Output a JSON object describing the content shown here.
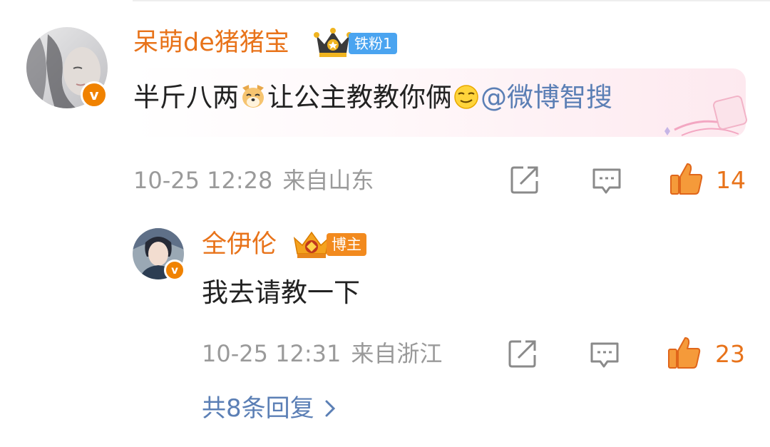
{
  "comment": {
    "username": "呆萌de猪猪宝",
    "fan_badge": "铁粉1",
    "text_before": "半斤八两",
    "text_middle": "让公主教教你俩",
    "mention": "@微博智搜",
    "time": "10-25 12:28",
    "location": "来自山东",
    "like_count": "14"
  },
  "reply": {
    "username": "全伊伦",
    "host_badge": "博主",
    "text": "我去请教一下",
    "time": "10-25 12:31",
    "location": "来自浙江",
    "like_count": "23"
  },
  "more_replies_label": "共8条回复",
  "colors": {
    "username": "#e8731a",
    "link": "#5b7fb5",
    "meta": "#9a9a9a",
    "fan_badge": "#4aa4f0",
    "host_badge": "#f28a1e"
  },
  "icons": [
    "share-icon",
    "comment-icon",
    "thumbs-up-icon",
    "dog-emoji-icon",
    "smirk-emoji-icon",
    "chevron-right-icon",
    "crown-icon",
    "verified-icon"
  ]
}
